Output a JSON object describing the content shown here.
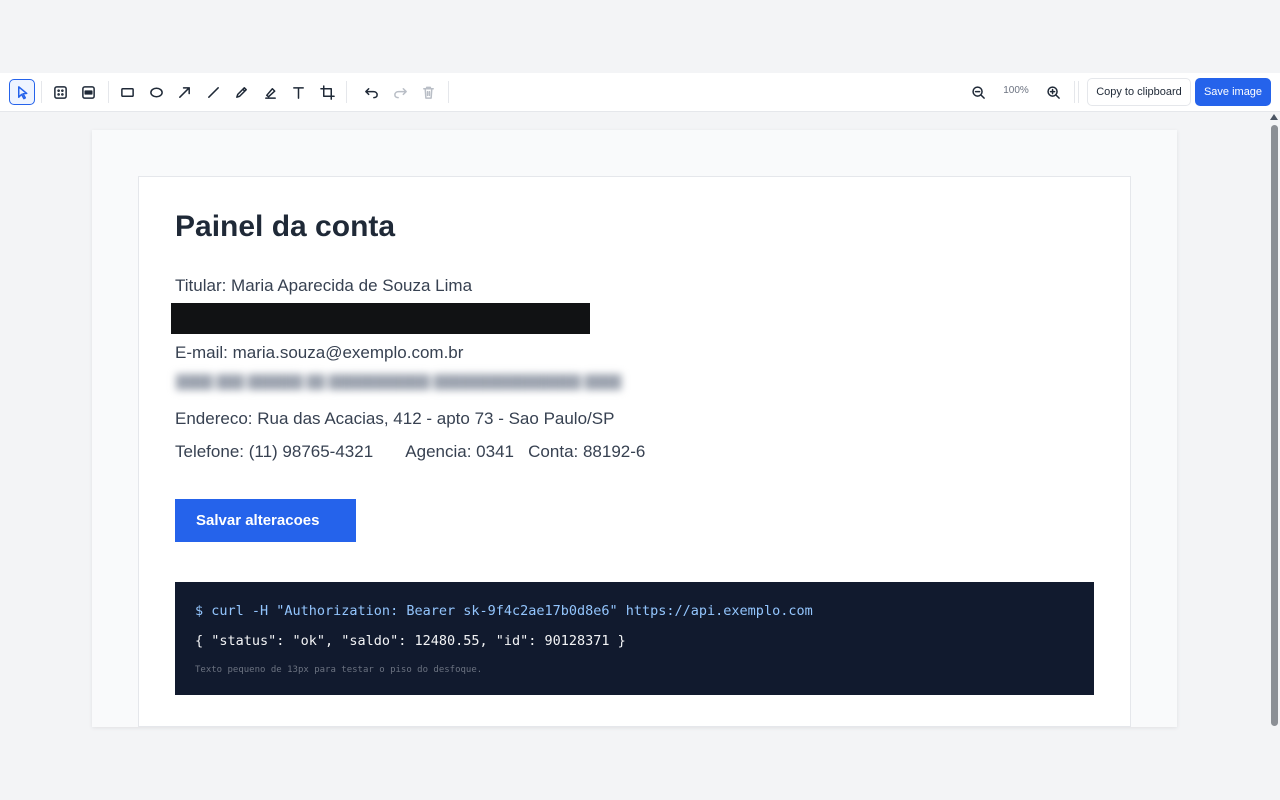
{
  "toolbar": {
    "tools": [
      {
        "name": "select-tool",
        "icon": "pointer-icon",
        "active": true
      },
      {
        "name": "blur-tool",
        "icon": "blur-icon"
      },
      {
        "name": "redact-tool",
        "icon": "redact-icon"
      },
      {
        "name": "rectangle-tool",
        "icon": "rectangle-icon"
      },
      {
        "name": "ellipse-tool",
        "icon": "ellipse-icon"
      },
      {
        "name": "arrow-tool",
        "icon": "arrow-icon"
      },
      {
        "name": "line-tool",
        "icon": "line-icon"
      },
      {
        "name": "pen-tool",
        "icon": "pencil-icon"
      },
      {
        "name": "highlighter-tool",
        "icon": "highlighter-icon"
      },
      {
        "name": "text-tool",
        "icon": "text-icon"
      },
      {
        "name": "crop-tool",
        "icon": "crop-icon"
      },
      {
        "name": "undo-button",
        "icon": "undo-icon"
      },
      {
        "name": "redo-button",
        "icon": "redo-icon",
        "disabled": true
      },
      {
        "name": "delete-button",
        "icon": "trash-icon",
        "disabled": true
      }
    ],
    "zoom_level": "100%",
    "copy_label": "Copy to clipboard",
    "save_label": "Save image",
    "accent_color": "#2563eb"
  },
  "document": {
    "title": "Painel da conta",
    "holder": "Titular: Maria Aparecida de Souza Lima",
    "email": "E-mail: maria.souza@exemplo.com.br",
    "address": "Endereco: Rua das Acacias, 412 - apto 73 - Sao Paulo/SP",
    "phone_line": "Telefone: (11) 98765-4321       Agencia: 0341   Conta: 88192-6",
    "save_button": "Salvar alteracoes",
    "code": {
      "command": "$ curl -H \"Authorization: Bearer sk-9f4c2ae17b0d8e6\" https://api.exemplo.com",
      "response": "{ \"status\": \"ok\", \"saldo\": 12480.55, \"id\": 90128371 }",
      "note": "Texto pequeno de 13px para testar o piso do desfoque."
    }
  }
}
